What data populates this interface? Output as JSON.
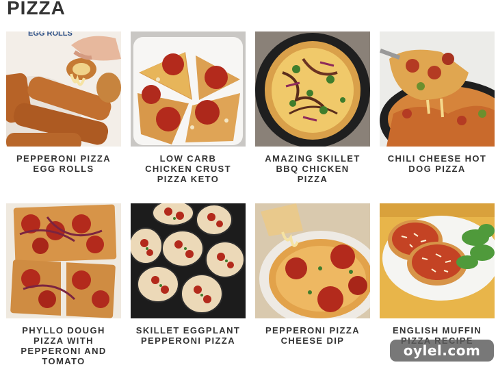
{
  "section": {
    "title": "PIZZA"
  },
  "recipes": [
    {
      "title": "PEPPERONI PIZZA EGG ROLLS",
      "image_text": "EGG ROLLS"
    },
    {
      "title": "LOW CARB CHICKEN CRUST PIZZA KETO"
    },
    {
      "title": "AMAZING SKILLET BBQ CHICKEN PIZZA"
    },
    {
      "title": "CHILI CHEESE HOT DOG PIZZA"
    },
    {
      "title": "PHYLLO DOUGH PIZZA WITH PEPPERONI AND TOMATO"
    },
    {
      "title": "SKILLET EGGPLANT PEPPERONI PIZZA"
    },
    {
      "title": "PEPPERONI PIZZA CHEESE DIP"
    },
    {
      "title": "ENGLISH MUFFIN PIZZA RECIPE"
    }
  ],
  "watermark": {
    "text": "oylel.com"
  },
  "colors": {
    "text": "#333333",
    "pepperoni": "#b32a1c",
    "crust": "#d9a04a",
    "skillet": "#1f1f1f"
  }
}
